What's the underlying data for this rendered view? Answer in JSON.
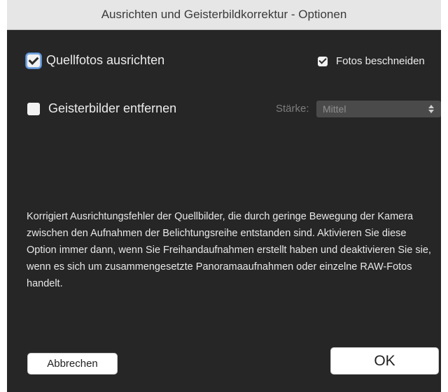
{
  "dialog": {
    "title": "Ausrichten und Geisterbildkorrektur - Optionen"
  },
  "options": {
    "align_source": {
      "label": "Quellfotos ausrichten",
      "checked": true
    },
    "crop_photos": {
      "label": "Fotos beschneiden",
      "checked": true
    },
    "remove_ghosts": {
      "label": "Geisterbilder entfernen",
      "checked": false
    }
  },
  "strength": {
    "label": "Stärke:",
    "selected": "Mittel"
  },
  "description": "Korrigiert Ausrichtungsfehler der Quellbilder, die durch geringe Bewegung der Kamera zwischen den Aufnahmen der Belichtungsreihe entstanden sind. Aktivieren Sie diese Option immer dann, wenn Sie Freihandaufnahmen erstellt haben und deaktivieren Sie sie, wenn es sich um zusammengesetzte Panoramaaufnahmen oder einzelne RAW-Fotos handelt.",
  "buttons": {
    "cancel": "Abbrechen",
    "ok": "OK"
  },
  "icons": {
    "select_chevron": "chevron-up-down-icon",
    "checkbox_check": "checkmark-icon"
  }
}
